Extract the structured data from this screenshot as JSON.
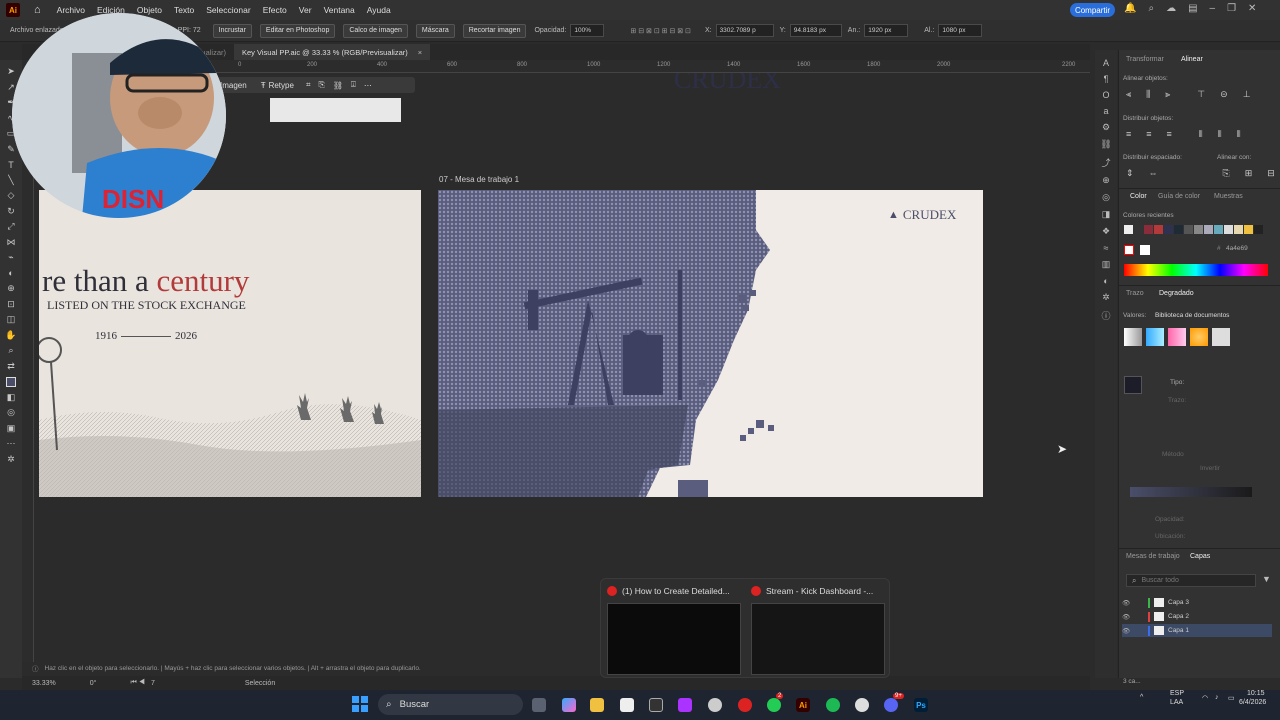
{
  "app": {
    "logo": "Ai",
    "home_icon": "home-icon"
  },
  "menu": [
    "Archivo",
    "Edición",
    "Objeto",
    "Texto",
    "Seleccionar",
    "Efecto",
    "Ver",
    "Ventana",
    "Ayuda"
  ],
  "share_label": "Compartir",
  "control_bar": {
    "embedded": "Archivo enlazado",
    "ppi": "PPI: 72",
    "embed_btn": "Incrustar",
    "edit_ps": "Editar en Photoshop",
    "image_trace": "Calco de imagen",
    "mask": "Máscara",
    "crop": "Recortar imagen",
    "opacity_label": "Opacidad:",
    "opacity_value": "100%",
    "x_label": "X:",
    "x_value": "3302.7089 p",
    "y_label": "Y:",
    "y_value": "94.8183 px",
    "w_label": "An.:",
    "w_value": "1920 px",
    "h_label": "Al.:",
    "h_value": "1080 px"
  },
  "tabs": [
    {
      "label": "(Previsualizar)",
      "active": false
    },
    {
      "label": "Key Visual PP.aic @ 33.33 % (RGB/Previsualizar)",
      "active": true,
      "close": "×"
    }
  ],
  "ruler_ticks": [
    "0",
    "200",
    "400",
    "600",
    "800",
    "1000",
    "1200",
    "1400",
    "1600",
    "1800",
    "2000",
    "2200"
  ],
  "context_bar": {
    "image_label": "Imagen",
    "retype": "Retype"
  },
  "artboard2_label": "07 - Mesa de trabajo 1",
  "artboard1": {
    "headline_a": "re than a ",
    "headline_b": "century",
    "subline": "LISTED ON THE STOCK EXCHANGE",
    "year_start": "1916",
    "year_end": "2026"
  },
  "artboard2": {
    "brand": "CRUDEX",
    "top_brand": "CRUDEX"
  },
  "colors": {
    "accent": "#2a6edb",
    "brand_navy": "#4a4e69",
    "brand_red": "#b33a3a",
    "artboard_bg": "#f0ebe7"
  },
  "right_panel": {
    "tabs": [
      "Transformar",
      "Alinear"
    ],
    "align_objects": "Alinear objetos:",
    "distribute_objects": "Distribuir objetos:",
    "distribute_spacing": "Distribuir espaciado:",
    "align_to": "Alinear con:",
    "color_tabs": [
      "Color",
      "Guía de color",
      "Muestras"
    ],
    "recent_colors": "Colores recientes",
    "hex_value": "4a4e69",
    "gradient_tabs": [
      "Trazo",
      "Degradado"
    ],
    "values_label": "Valores:",
    "values_select": "Biblioteca de documentos",
    "type_label": "Tipo:",
    "stroke_label": "Trazo:",
    "method_label": "Método",
    "reverse_label": "Invertir",
    "opacity_label": "Opacidad:",
    "location_label": "Ubicación:",
    "layer_tabs": [
      "Mesas de trabajo",
      "Capas"
    ],
    "search_placeholder": "Buscar todo",
    "layers": [
      "Capa 3",
      "Capa 2",
      "Capa 1"
    ],
    "layer_colors": [
      "#3ab54a",
      "#e04040",
      "#3a6ee8"
    ],
    "layers_count": "3 ca..."
  },
  "status": {
    "hint": "Haz clic en el objeto para seleccionarlo. | Mayús + haz clic para seleccionar varios objetos. | Alt + arrastra el objeto para duplicarlo.",
    "zoom": "33.33%",
    "rotation": "0°",
    "artboard_num": "7",
    "mode": "Selección"
  },
  "taskbar": {
    "search": "Buscar",
    "lang": "ESP",
    "lang2": "LAA",
    "time": "10:15",
    "date": "6/4/2026",
    "badge_whatsapp": "2",
    "badge_discord": "9+"
  },
  "preview": {
    "window1": "(1) How to Create Detailed...",
    "window2": "Stream - Kick Dashboard -..."
  }
}
